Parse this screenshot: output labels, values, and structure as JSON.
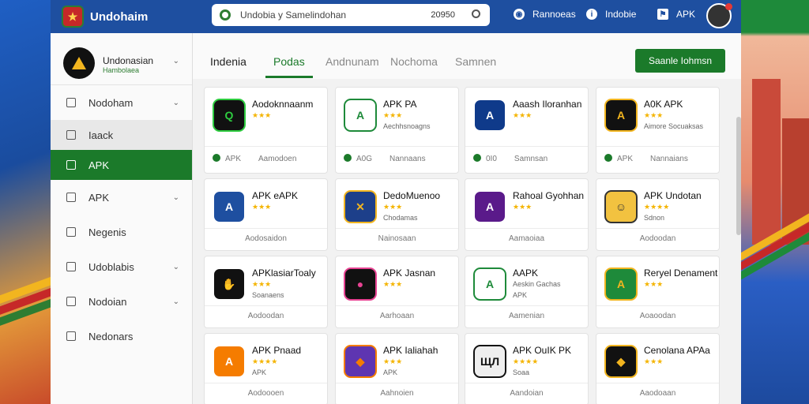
{
  "topbar": {
    "brand": "Undohaim",
    "search_placeholder": "Undobia y Samelindohan",
    "search_value": "20950",
    "items": [
      {
        "label": "Rannoeas"
      },
      {
        "label": "Indobie"
      },
      {
        "label": "APK"
      }
    ]
  },
  "sidebar": {
    "profile_name": "Undonasian",
    "profile_sub": "Hambolaea",
    "items": [
      {
        "label": "Nodoham",
        "chevron": true
      },
      {
        "label": "Iaack",
        "chevron": false
      },
      {
        "label": "APK",
        "chevron": false
      },
      {
        "label": "APK",
        "chevron": true
      },
      {
        "label": "Negenis",
        "chevron": false
      },
      {
        "label": "Udoblabis",
        "chevron": true
      },
      {
        "label": "Nodoian",
        "chevron": true
      },
      {
        "label": "Nedonars",
        "chevron": false
      }
    ]
  },
  "tabs": [
    "Indenia",
    "Podas",
    "Andnunam",
    "Nochoma",
    "Samnen"
  ],
  "cta_label": "Saanle Iohmsn",
  "cards": [
    {
      "title": "Aodoknnaanm",
      "stars": "★★★",
      "sub": "",
      "foot": "APK",
      "foot_extra": "Aamodoen",
      "color": "#111111",
      "accent": "#2ecc40",
      "glyph": "Q"
    },
    {
      "title": "APK PA",
      "stars": "★★★",
      "sub": "Aechhsnoagns",
      "foot": "A0G",
      "foot_extra": "Nannaans",
      "color": "#ffffff",
      "accent": "#1e8a3a",
      "glyph": "A"
    },
    {
      "title": "Aaash Iloranhan",
      "stars": "★★★",
      "sub": "",
      "foot": "0I0",
      "foot_extra": "Samnsan",
      "color": "#0f3a8a",
      "accent": "#ffffff",
      "glyph": "A"
    },
    {
      "title": "A0K APK",
      "stars": "★★★",
      "sub": "Aimore Socuaksas",
      "foot": "APK",
      "foot_extra": "Nannaians",
      "color": "#111111",
      "accent": "#f2b51f",
      "glyph": "A"
    },
    {
      "title": "APK eAPK",
      "stars": "★★★",
      "sub": "",
      "foot": "Aodosaidon",
      "foot_extra": "",
      "color": "#1e4fa0",
      "accent": "#ffffff",
      "glyph": "A"
    },
    {
      "title": "DedoMuenoo",
      "stars": "★★★",
      "sub": "Chodamas",
      "foot": "Nainosaan",
      "foot_extra": "",
      "color": "#1d3f8a",
      "accent": "#f2b51f",
      "glyph": "✕"
    },
    {
      "title": "Rahoal Gyohhan",
      "stars": "★★★",
      "sub": "",
      "foot": "Aamaoiaa",
      "foot_extra": "",
      "color": "#5a1a8a",
      "accent": "#ffffff",
      "glyph": "A"
    },
    {
      "title": "APK Undotan",
      "stars": "★★★★",
      "sub": "Sdnon",
      "foot": "Aodoodan",
      "foot_extra": "",
      "color": "#f2c240",
      "accent": "#333333",
      "glyph": "☺"
    },
    {
      "title": "APKlasiarToaly",
      "stars": "★★★",
      "sub": "Soanaens",
      "foot": "Aodoodan",
      "foot_extra": "",
      "color": "#111111",
      "accent": "#ffffff",
      "glyph": "✋"
    },
    {
      "title": "APK Jasnan",
      "stars": "★★★",
      "sub": "",
      "foot": "Aarhoaan",
      "foot_extra": "",
      "color": "#111111",
      "accent": "#e84393",
      "glyph": "●"
    },
    {
      "title": "AAPK",
      "stars": "",
      "sub": "Aeskin Gachas",
      "sub2": "APK",
      "foot": "Aamenian",
      "foot_extra": "",
      "color": "#ffffff",
      "accent": "#1e8a3a",
      "glyph": "A"
    },
    {
      "title": "Reryel Denament",
      "stars": "★★★",
      "sub": "",
      "foot": "Aoaoodan",
      "foot_extra": "",
      "color": "#1e8a3a",
      "accent": "#f2b51f",
      "glyph": "A"
    },
    {
      "title": "APK Pnaad",
      "stars": "★★★★",
      "sub": "APK",
      "foot": "Aodoooen",
      "foot_extra": "",
      "color": "#f57c00",
      "accent": "#ffffff",
      "glyph": "A"
    },
    {
      "title": "APK Ialiahah",
      "stars": "★★★",
      "sub": "APK",
      "foot": "Aahnoien",
      "foot_extra": "",
      "color": "#5e35b1",
      "accent": "#f57c00",
      "glyph": "◆"
    },
    {
      "title": "APK OuIK PK",
      "stars": "★★★★",
      "sub": "Soaa",
      "foot": "Aandoian",
      "foot_extra": "",
      "color": "#eeeeee",
      "accent": "#111111",
      "glyph": "ЩЛ"
    },
    {
      "title": "Cenolana APAa",
      "stars": "★★★",
      "sub": "",
      "foot": "Aaodoaan",
      "foot_extra": "",
      "color": "#111111",
      "accent": "#f2b51f",
      "glyph": "◆"
    }
  ]
}
